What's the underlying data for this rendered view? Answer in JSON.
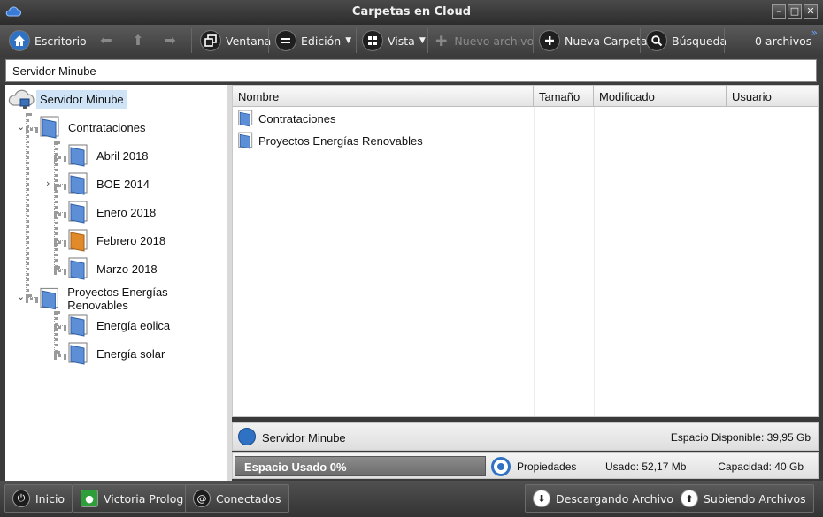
{
  "window": {
    "title": "Carpetas en Cloud"
  },
  "toolbar": {
    "escritorio": "Escritorio",
    "ventana": "Ventana",
    "edicion": "Edición",
    "vista": "Vista",
    "nuevo_archivo": "Nuevo archivo",
    "nueva_carpeta": "Nueva Carpeta",
    "busqueda": "Búsqueda",
    "file_count": "0 archivos",
    "more": "»"
  },
  "address": {
    "path": "Servidor Minube"
  },
  "tree": {
    "root": "Servidor Minube",
    "items": [
      {
        "label": "Contrataciones"
      },
      {
        "label": "Abril 2018"
      },
      {
        "label": "BOE 2014"
      },
      {
        "label": "Enero 2018"
      },
      {
        "label": "Febrero 2018"
      },
      {
        "label": "Marzo 2018"
      },
      {
        "label": "Proyectos Energías Renovables"
      },
      {
        "label": "Energía eolica"
      },
      {
        "label": "Energía solar"
      }
    ]
  },
  "list": {
    "columns": [
      "Nombre",
      "Tamaño",
      "Modificado",
      "Usuario"
    ],
    "rows": [
      {
        "name": "Contrataciones"
      },
      {
        "name": "Proyectos Energías Renovables"
      }
    ]
  },
  "info": {
    "server": "Servidor Minube",
    "space_available": "Espacio Disponible: 39,95 Gb",
    "space_used": "Espacio Usado 0%",
    "space_used_fraction": 0,
    "properties": "Propiedades",
    "used": "Usado: 52,17 Mb",
    "capacity": "Capacidad: 40 Gb"
  },
  "status": {
    "inicio": "Inicio",
    "user": "Victoria Prolog",
    "conectados": "Conectados",
    "descargando": "Descargando Archivos",
    "subiendo": "Subiendo Archivos"
  },
  "colors": {
    "folder_blue": "#5d8fd6",
    "folder_orange": "#e08a2a",
    "accent": "#2f72c4"
  }
}
